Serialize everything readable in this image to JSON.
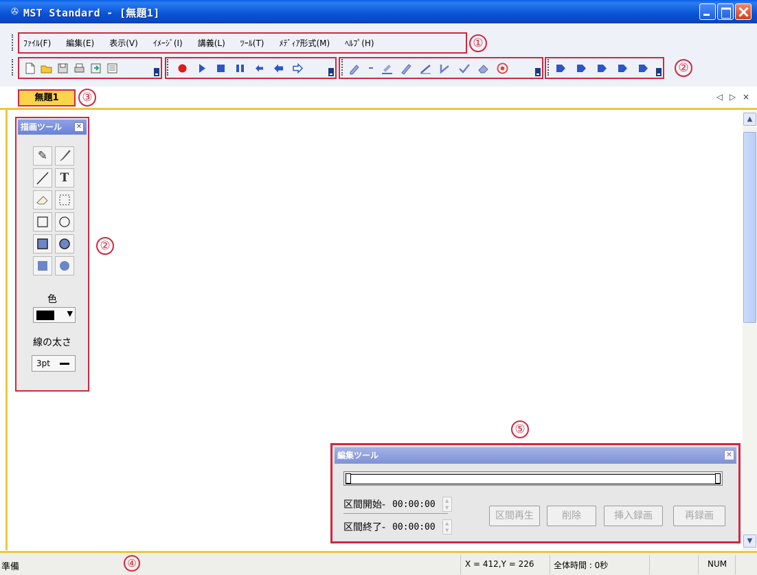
{
  "window": {
    "title": "MST Standard - [無題1]",
    "app_icon": "app-logo-icon"
  },
  "menu": {
    "items": [
      {
        "label": "ﾌｧｲﾙ(F)"
      },
      {
        "label": "編集(E)"
      },
      {
        "label": "表示(V)"
      },
      {
        "label": "ｲﾒｰｼﾞ(I)"
      },
      {
        "label": "講義(L)"
      },
      {
        "label": "ﾂｰﾙ(T)"
      },
      {
        "label": "ﾒﾃﾞｨｱ形式(M)"
      },
      {
        "label": "ﾍﾙﾌﾟ(H)"
      }
    ]
  },
  "toolbars": {
    "file": [
      "new-document-icon",
      "open-folder-icon",
      "save-icon",
      "print-icon",
      "import-icon",
      "properties-icon"
    ],
    "record": [
      "record-icon",
      "play-icon",
      "stop-icon",
      "pause-icon",
      "prev-icon",
      "back-icon",
      "forward-icon"
    ],
    "draw": [
      "pen-icon",
      "arrow-down-icon",
      "highlighter-icon",
      "pen-icon",
      "line-icon",
      "check-icon",
      "check-icon",
      "eraser-icon",
      "zoom-icon"
    ],
    "extra": [
      "slide-icon",
      "slide-icon",
      "slide-icon",
      "slide-icon",
      "slide-icon"
    ],
    "record_color": "#e01c1c",
    "accent_blue": "#2b55c8"
  },
  "annotations": {
    "menubar": "①",
    "toolbar": "②",
    "palette": "②",
    "tab": "③",
    "statusbar": "④",
    "editpanel": "⑤"
  },
  "tabs": {
    "active": "無題1",
    "nav": "◁ ▷ ×"
  },
  "draw_palette": {
    "title": "描画ツール",
    "tools": [
      {
        "icon": "pencil-icon",
        "glyph": "✎"
      },
      {
        "icon": "brush-icon",
        "glyph": "🖌"
      },
      {
        "icon": "line-icon",
        "glyph": "╱"
      },
      {
        "icon": "text-icon",
        "glyph": "T"
      },
      {
        "icon": "eraser-icon",
        "glyph": "⌫"
      },
      {
        "icon": "select-rect-icon",
        "glyph": "⬚"
      },
      {
        "icon": "rectangle-icon",
        "glyph": "□"
      },
      {
        "icon": "ellipse-icon",
        "glyph": "○"
      },
      {
        "icon": "filled-rectangle-icon",
        "glyph": "■"
      },
      {
        "icon": "filled-ellipse-icon",
        "glyph": "●"
      },
      {
        "icon": "solid-rectangle-icon",
        "glyph": "■"
      },
      {
        "icon": "solid-ellipse-icon",
        "glyph": "●"
      }
    ],
    "color_label": "色",
    "color_value": "#000000",
    "line_width_label": "線の太さ",
    "line_width_value": "3pt"
  },
  "edit_panel": {
    "title": "編集ツール",
    "range_start_label": "区間開始-",
    "range_start_value": "00:00:00",
    "range_end_label": "区間終了-",
    "range_end_value": "00:00:00",
    "buttons": {
      "play": "区間再生",
      "delete": "削除",
      "insert": "挿入録画",
      "rerecord": "再録画"
    }
  },
  "status": {
    "text": "準備",
    "coords": "X = 412,Y = 226",
    "total_time": "全体時間 :  0秒",
    "num": "NUM"
  }
}
